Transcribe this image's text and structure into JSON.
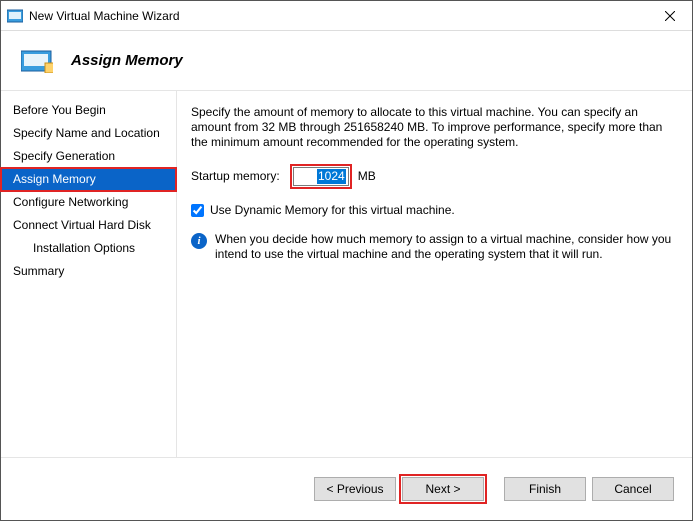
{
  "window": {
    "title": "New Virtual Machine Wizard"
  },
  "header": {
    "title": "Assign Memory"
  },
  "sidebar": {
    "items": [
      {
        "label": "Before You Begin"
      },
      {
        "label": "Specify Name and Location"
      },
      {
        "label": "Specify Generation"
      },
      {
        "label": "Assign Memory"
      },
      {
        "label": "Configure Networking"
      },
      {
        "label": "Connect Virtual Hard Disk"
      },
      {
        "label": "Installation Options"
      },
      {
        "label": "Summary"
      }
    ]
  },
  "content": {
    "description": "Specify the amount of memory to allocate to this virtual machine. You can specify an amount from 32 MB through 251658240 MB. To improve performance, specify more than the minimum amount recommended for the operating system.",
    "startup_label": "Startup memory:",
    "startup_value": "1024",
    "startup_unit": "MB",
    "dynamic_label": "Use Dynamic Memory for this virtual machine.",
    "dynamic_checked": true,
    "info_text": "When you decide how much memory to assign to a virtual machine, consider how you intend to use the virtual machine and the operating system that it will run."
  },
  "footer": {
    "previous": "< Previous",
    "next": "Next >",
    "finish": "Finish",
    "cancel": "Cancel"
  }
}
